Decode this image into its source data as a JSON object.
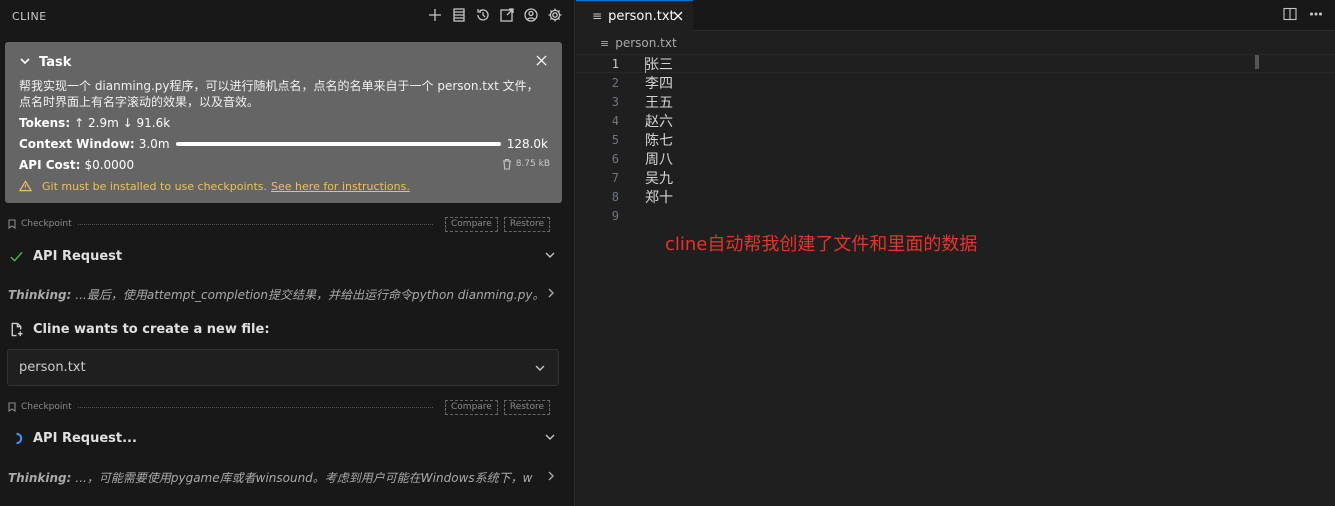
{
  "left_panel": {
    "title": "CLINE",
    "header_icons": [
      "plus-icon",
      "server-icon",
      "history-icon",
      "popout-icon",
      "account-icon",
      "gear-icon"
    ]
  },
  "task": {
    "title": "Task",
    "text": "帮我实现一个 dianming.py程序，可以进行随机点名，点名的名单来自于一个 person.txt 文件，点名时界面上有名字滚动的效果，以及音效。",
    "tokens_label": "Tokens:",
    "tokens_up": "↑ 2.9m",
    "tokens_down": "↓ 91.6k",
    "context_label": "Context Window:",
    "context_used": "3.0m",
    "context_max": "128.0k",
    "context_fill": 1.0,
    "cost_label": "API Cost:",
    "cost_value": "$0.0000",
    "size": "8.75 kB",
    "warning_text": "Git must be installed to use checkpoints.",
    "warning_link": "See here for instructions."
  },
  "checkpoint": {
    "label": "Checkpoint",
    "compare": "Compare",
    "restore": "Restore"
  },
  "messages": {
    "api_request_done": "API Request",
    "thinking_label": "Thinking:",
    "thinking_1": "...最后，使用attempt_completion提交结果，并给出运行命令python dianming.py。",
    "create_file": "Cline wants to create a new file:",
    "file_name": "person.txt",
    "api_request_pending": "API Request...",
    "thinking_2": "...，可能需要使用pygame库或者winsound。考虑到用户可能在Windows系统下，w"
  },
  "editor": {
    "tab_name": "person.txt",
    "breadcrumb": "person.txt",
    "lines": [
      {
        "n": "1",
        "text": "张三"
      },
      {
        "n": "2",
        "text": "李四"
      },
      {
        "n": "3",
        "text": "王五"
      },
      {
        "n": "4",
        "text": "赵六"
      },
      {
        "n": "5",
        "text": "陈七"
      },
      {
        "n": "6",
        "text": "周八"
      },
      {
        "n": "7",
        "text": "吴九"
      },
      {
        "n": "8",
        "text": "郑十"
      },
      {
        "n": "9",
        "text": ""
      }
    ],
    "annotation": "cline自动帮我创建了文件和里面的数据"
  },
  "colors": {
    "accent": "#0078d4",
    "success": "#3fb950",
    "warning": "#e8c25a",
    "annotation": "#e8322a"
  }
}
